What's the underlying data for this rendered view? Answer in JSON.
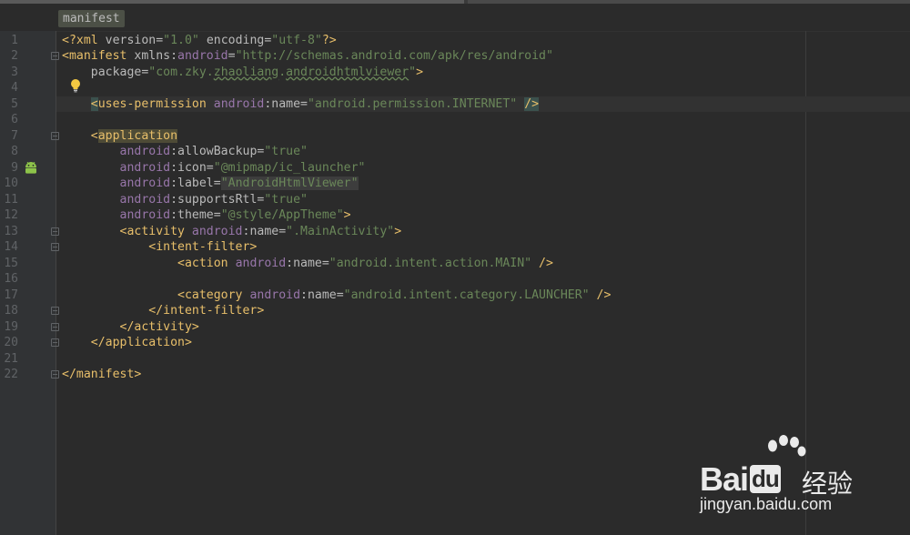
{
  "editor": {
    "breadcrumb": "manifest",
    "colors": {
      "background": "#2b2b2b",
      "gutter": "#313335",
      "tag": "#e8bf6a",
      "namespace": "#9876aa",
      "string": "#6a8759",
      "attribute": "#bababa",
      "line_number": "#606366"
    },
    "lines": [
      {
        "n": "1",
        "tokens": [
          {
            "t": "<?xml ",
            "c": "t-punc"
          },
          {
            "t": "version=",
            "c": "t-attr"
          },
          {
            "t": "\"1.0\"",
            "c": "t-str"
          },
          {
            "t": " encoding=",
            "c": "t-attr"
          },
          {
            "t": "\"utf-8\"",
            "c": "t-str"
          },
          {
            "t": "?>",
            "c": "t-punc"
          }
        ]
      },
      {
        "n": "2",
        "tokens": [
          {
            "t": "<manifest ",
            "c": "t-tag"
          },
          {
            "t": "xmlns:",
            "c": "t-attr"
          },
          {
            "t": "android",
            "c": "t-ns"
          },
          {
            "t": "=",
            "c": "t-attr"
          },
          {
            "t": "\"http://schemas.android.com/apk/res/android\"",
            "c": "t-str"
          }
        ]
      },
      {
        "n": "3",
        "tokens": [
          {
            "t": "    package=",
            "c": "t-attr"
          },
          {
            "t": "\"com.zky.",
            "c": "t-str"
          },
          {
            "t": "zhaoliang",
            "c": "t-str u"
          },
          {
            "t": ".",
            "c": "t-str"
          },
          {
            "t": "androidhtmlviewer",
            "c": "t-str u"
          },
          {
            "t": "\"",
            "c": "t-str"
          },
          {
            "t": ">",
            "c": "t-tag"
          }
        ]
      },
      {
        "n": "4",
        "tokens": []
      },
      {
        "n": "5",
        "tokens": [
          {
            "t": "    ",
            "c": "t-text"
          },
          {
            "t": "<",
            "c": "t-tag hl-tag"
          },
          {
            "t": "uses-permission ",
            "c": "t-tag"
          },
          {
            "t": "android",
            "c": "t-ns"
          },
          {
            "t": ":name=",
            "c": "t-attr"
          },
          {
            "t": "\"android.permission.INTERNET\"",
            "c": "t-str"
          },
          {
            "t": " ",
            "c": "t-text"
          },
          {
            "t": "/>",
            "c": "t-tag hl-tag"
          }
        ]
      },
      {
        "n": "6",
        "tokens": []
      },
      {
        "n": "7",
        "tokens": [
          {
            "t": "    <",
            "c": "t-tag"
          },
          {
            "t": "application",
            "c": "t-tag hl-word"
          }
        ]
      },
      {
        "n": "8",
        "tokens": [
          {
            "t": "        ",
            "c": "t-text"
          },
          {
            "t": "android",
            "c": "t-ns"
          },
          {
            "t": ":allowBackup=",
            "c": "t-attr"
          },
          {
            "t": "\"true\"",
            "c": "t-str"
          }
        ]
      },
      {
        "n": "9",
        "tokens": [
          {
            "t": "        ",
            "c": "t-text"
          },
          {
            "t": "android",
            "c": "t-ns"
          },
          {
            "t": ":icon=",
            "c": "t-attr"
          },
          {
            "t": "\"@mipmap/ic_launcher\"",
            "c": "t-str"
          }
        ]
      },
      {
        "n": "10",
        "tokens": [
          {
            "t": "        ",
            "c": "t-text"
          },
          {
            "t": "android",
            "c": "t-ns"
          },
          {
            "t": ":label=",
            "c": "t-attr"
          },
          {
            "t": "\"AndroidHtmlViewer\"",
            "c": "t-str hl-label"
          }
        ]
      },
      {
        "n": "11",
        "tokens": [
          {
            "t": "        ",
            "c": "t-text"
          },
          {
            "t": "android",
            "c": "t-ns"
          },
          {
            "t": ":supportsRtl=",
            "c": "t-attr"
          },
          {
            "t": "\"true\"",
            "c": "t-str"
          }
        ]
      },
      {
        "n": "12",
        "tokens": [
          {
            "t": "        ",
            "c": "t-text"
          },
          {
            "t": "android",
            "c": "t-ns"
          },
          {
            "t": ":theme=",
            "c": "t-attr"
          },
          {
            "t": "\"@style/AppTheme\"",
            "c": "t-str"
          },
          {
            "t": ">",
            "c": "t-tag"
          }
        ]
      },
      {
        "n": "13",
        "tokens": [
          {
            "t": "        <activity ",
            "c": "t-tag"
          },
          {
            "t": "android",
            "c": "t-ns"
          },
          {
            "t": ":name=",
            "c": "t-attr"
          },
          {
            "t": "\".MainActivity\"",
            "c": "t-str"
          },
          {
            "t": ">",
            "c": "t-tag"
          }
        ]
      },
      {
        "n": "14",
        "tokens": [
          {
            "t": "            <intent-filter>",
            "c": "t-tag"
          }
        ]
      },
      {
        "n": "15",
        "tokens": [
          {
            "t": "                <action ",
            "c": "t-tag"
          },
          {
            "t": "android",
            "c": "t-ns"
          },
          {
            "t": ":name=",
            "c": "t-attr"
          },
          {
            "t": "\"android.intent.action.MAIN\"",
            "c": "t-str"
          },
          {
            "t": " />",
            "c": "t-tag"
          }
        ]
      },
      {
        "n": "16",
        "tokens": []
      },
      {
        "n": "17",
        "tokens": [
          {
            "t": "                <category ",
            "c": "t-tag"
          },
          {
            "t": "android",
            "c": "t-ns"
          },
          {
            "t": ":name=",
            "c": "t-attr"
          },
          {
            "t": "\"android.intent.category.LAUNCHER\"",
            "c": "t-str"
          },
          {
            "t": " />",
            "c": "t-tag"
          }
        ]
      },
      {
        "n": "18",
        "tokens": [
          {
            "t": "            </intent-filter>",
            "c": "t-tag"
          }
        ]
      },
      {
        "n": "19",
        "tokens": [
          {
            "t": "        </activity>",
            "c": "t-tag"
          }
        ]
      },
      {
        "n": "20",
        "tokens": [
          {
            "t": "    </application>",
            "c": "t-tag"
          }
        ]
      },
      {
        "n": "21",
        "tokens": []
      },
      {
        "n": "22",
        "tokens": [
          {
            "t": "</manifest>",
            "c": "t-tag"
          }
        ]
      }
    ],
    "current_line": 5,
    "fold_markers": [
      "2",
      "7",
      "13",
      "14",
      "18",
      "19",
      "20",
      "22"
    ],
    "gutter_icons": [
      {
        "line": "4",
        "icon": "lightbulb-icon"
      },
      {
        "line": "9",
        "icon": "android-icon"
      }
    ]
  },
  "watermark": {
    "brand": "Bai",
    "brand2": "du",
    "cn": "经验",
    "url": "jingyan.baidu.com"
  }
}
